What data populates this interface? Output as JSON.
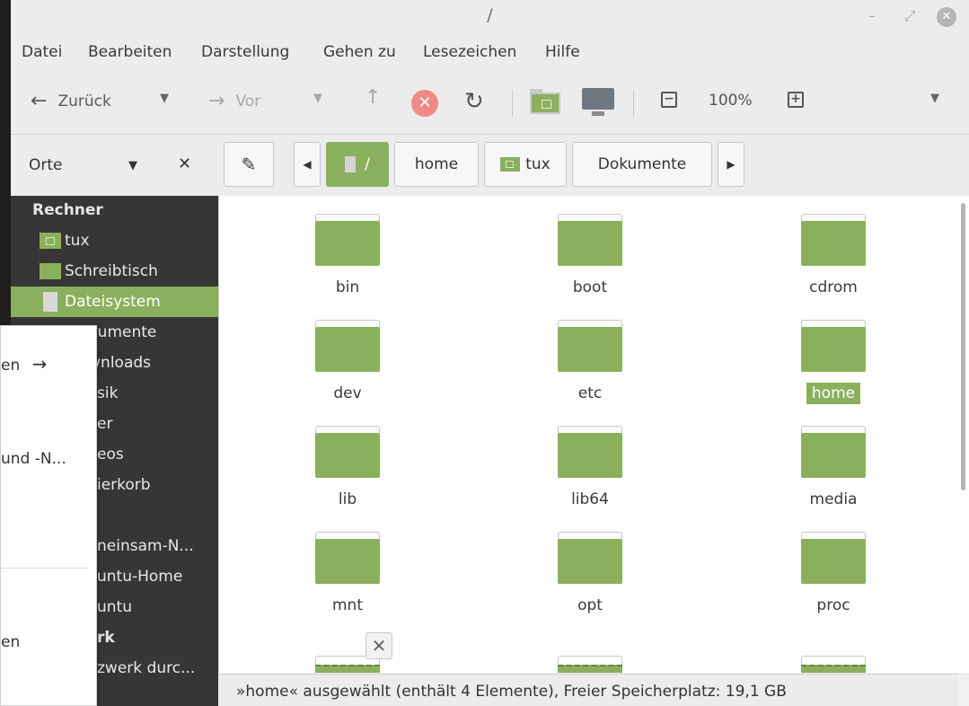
{
  "window": {
    "title": "/"
  },
  "menubar": [
    "Datei",
    "Bearbeiten",
    "Darstellung",
    "Gehen zu",
    "Lesezeichen",
    "Hilfe"
  ],
  "toolbar": {
    "back": "Zurück",
    "forward": "Vor",
    "zoom": "100%"
  },
  "sidebar": {
    "header": "Orte",
    "sections": [
      {
        "title": "Rechner"
      }
    ],
    "items": [
      {
        "label": "tux",
        "icon": "home-folder-icon"
      },
      {
        "label": "Schreibtisch",
        "icon": "folder-icon"
      },
      {
        "label": "Dateisystem",
        "icon": "drive-icon",
        "selected": true
      },
      {
        "label": "tumente"
      },
      {
        "label": "vnloads"
      },
      {
        "label": "sik"
      },
      {
        "label": "er"
      },
      {
        "label": "eos"
      },
      {
        "label": "ierkorb"
      },
      {
        "label": "neinsam-N..."
      },
      {
        "label": "untu-Home"
      },
      {
        "label": "untu"
      },
      {
        "label": "rk"
      },
      {
        "label": "zwerk durc..."
      }
    ]
  },
  "pathbar": {
    "crumbs": [
      "/",
      "home",
      "tux",
      "Dokumente"
    ]
  },
  "files": [
    {
      "name": "bin"
    },
    {
      "name": "boot"
    },
    {
      "name": "cdrom"
    },
    {
      "name": "dev"
    },
    {
      "name": "etc"
    },
    {
      "name": "home",
      "selected": true
    },
    {
      "name": "lib"
    },
    {
      "name": "lib64"
    },
    {
      "name": "media"
    },
    {
      "name": "mnt"
    },
    {
      "name": "opt"
    },
    {
      "name": "proc"
    }
  ],
  "statusbar": {
    "text": "»home« ausgewählt (enthält 4 Elemente), Freier Speicherplatz: 19,1 GB"
  },
  "context_menu": {
    "items": [
      {
        "label": "en",
        "arrow": "→"
      },
      {
        "label": "und -N..."
      },
      {
        "label": "en"
      }
    ]
  },
  "colors": {
    "accent": "#8bb05d",
    "sidebar_bg": "#363636"
  }
}
